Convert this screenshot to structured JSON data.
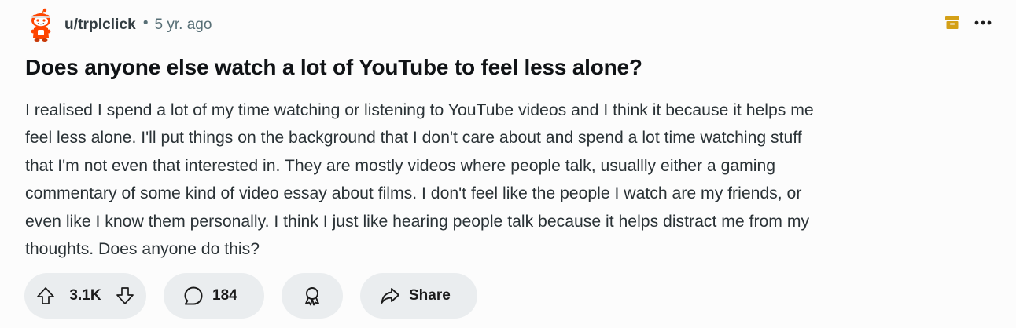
{
  "post": {
    "username": "u/trplclick",
    "separator": "•",
    "timestamp": "5 yr. ago",
    "title": "Does anyone else watch a lot of YouTube to feel less alone?",
    "body_lines": [
      "I realised I spend a lot of my time watching or listening to YouTube videos and I think it because it helps me",
      "feel less alone. I'll put things on the background that I don't care about and spend a lot time watching stuff",
      "that I'm not even that interested in. They are mostly videos where people talk, usuallly either a gaming",
      "commentary of some kind of video essay about films. I don't feel like the people I watch are my friends, or",
      "even like I know them personally. I think I just like hearing people talk because it helps distract me from my",
      "thoughts. Does anyone do this?"
    ]
  },
  "actions": {
    "vote_count": "3.1K",
    "comment_count": "184",
    "share_label": "Share"
  },
  "icons": {
    "avatar": "snoo-avatar-icon",
    "archive": "archive-icon",
    "more": "more-options-icon",
    "upvote": "upvote-arrow-icon",
    "downvote": "downvote-arrow-icon",
    "comment": "comment-bubble-icon",
    "award": "award-icon",
    "share": "share-arrow-icon"
  },
  "colors": {
    "background": "#fcfcfc",
    "pill": "#eaedef",
    "archive_icon": "#d4a017",
    "avatar_orange": "#ff4500",
    "meta_text": "#576f76"
  }
}
